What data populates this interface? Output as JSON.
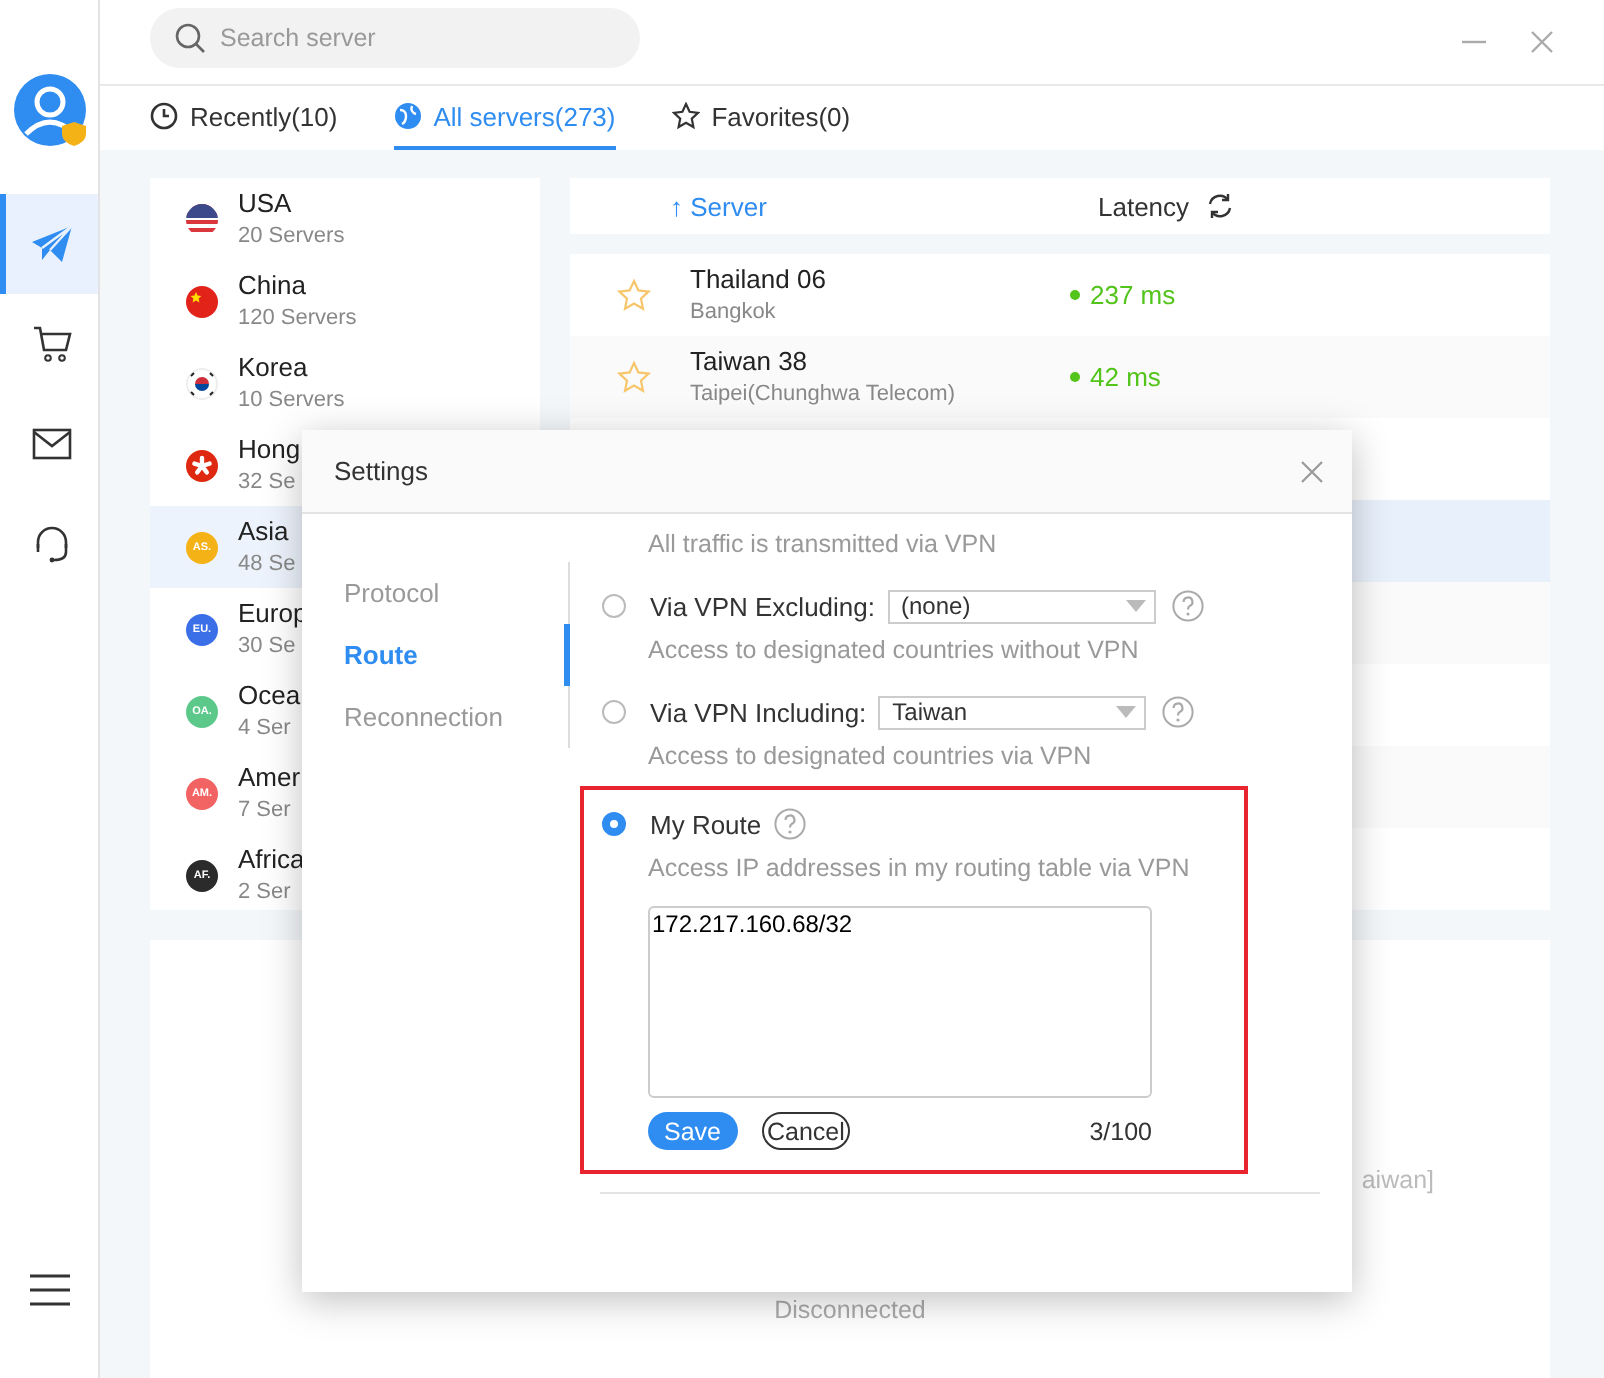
{
  "search": {
    "placeholder": "Search server"
  },
  "sidebar": {
    "items": [
      {
        "selected": true
      },
      {
        "selected": false
      },
      {
        "selected": false
      },
      {
        "selected": false
      }
    ]
  },
  "tabs": [
    {
      "label": "Recently(10)",
      "selected": false
    },
    {
      "label": "All servers(273)",
      "selected": true
    },
    {
      "label": "Favorites(0)",
      "selected": false
    }
  ],
  "regions": [
    {
      "name": "USA",
      "count": "20 Servers",
      "kind": "flag",
      "selected": false
    },
    {
      "name": "China",
      "count": "120 Servers",
      "kind": "flag",
      "selected": false
    },
    {
      "name": "Korea",
      "count": "10 Servers",
      "kind": "flag",
      "selected": false
    },
    {
      "name": "Hong",
      "count": "32 Se",
      "kind": "flag",
      "selected": false
    },
    {
      "name": "Asia",
      "count": "48 Se",
      "kind": "badge",
      "badge": "AS.",
      "color": "#f5b217",
      "selected": true
    },
    {
      "name": "Europ",
      "count": "30 Se",
      "kind": "badge",
      "badge": "EU.",
      "color": "#3b6fe8",
      "selected": false
    },
    {
      "name": "Ocea",
      "count": "4 Ser",
      "kind": "badge",
      "badge": "OA.",
      "color": "#5cc98a",
      "selected": false
    },
    {
      "name": "Amer",
      "count": "7 Ser",
      "kind": "badge",
      "badge": "AM.",
      "color": "#f26464",
      "selected": false
    },
    {
      "name": "Africa",
      "count": "2 Ser",
      "kind": "badge",
      "badge": "AF.",
      "color": "#2b2b2b",
      "selected": false
    }
  ],
  "server_table": {
    "columns": [
      "↑ Server",
      "Latency"
    ],
    "rows": [
      {
        "name": "Thailand 06",
        "location": "Bangkok",
        "latency": "237 ms",
        "color": "#52c41a",
        "favorite": false
      },
      {
        "name": "Taiwan 38",
        "location": "Taipei(Chunghwa Telecom)",
        "latency": "42 ms",
        "color": "#52c41a",
        "favorite": false
      }
    ]
  },
  "connection": {
    "route_note": "aiwan]",
    "status": "Disconnected"
  },
  "settings": {
    "title": "Settings",
    "nav": [
      {
        "label": "Protocol",
        "selected": false
      },
      {
        "label": "Route",
        "selected": true
      },
      {
        "label": "Reconnection",
        "selected": false
      }
    ],
    "options": [
      {
        "kind": "note",
        "description": "All traffic is transmitted via VPN",
        "highlighted": false
      },
      {
        "kind": "select",
        "label": "Via VPN Excluding:",
        "value": "(none)",
        "selected": false,
        "highlighted": false,
        "description": "Access to designated countries without VPN"
      },
      {
        "kind": "select",
        "label": "Via VPN Including:",
        "value": "Taiwan",
        "selected": false,
        "highlighted": false,
        "description": "Access to designated countries via VPN"
      },
      {
        "kind": "table",
        "label": "My Route",
        "selected": true,
        "highlighted": true,
        "description": "Access IP addresses in my routing table via VPN",
        "routes": "172.217.160.68/32",
        "counter": "3/100",
        "buttons": [
          {
            "label": "Save",
            "kind": "primary"
          },
          {
            "label": "Cancel",
            "kind": "outline"
          }
        ]
      }
    ]
  }
}
